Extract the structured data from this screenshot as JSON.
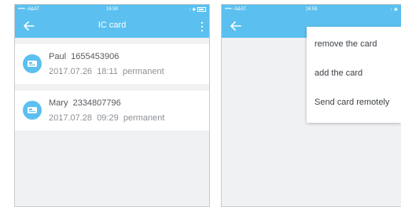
{
  "status_bar": {
    "carrier": "••••◦ A&AT",
    "time": "16:59",
    "right": "↑ ✱"
  },
  "left": {
    "title": "IC card",
    "cards": [
      {
        "name": "Paul",
        "number": "1655453906",
        "date": "2017.07.26",
        "time": "18:11",
        "validity": "permanent"
      },
      {
        "name": "Mary",
        "number": "2334807796",
        "date": "2017.07.28",
        "time": "09:29",
        "validity": "permanent"
      }
    ]
  },
  "right": {
    "menu": [
      {
        "label": "remove the card"
      },
      {
        "label": "add the card"
      },
      {
        "label": "Send card remotely"
      }
    ]
  },
  "colors": {
    "accent": "#5bc0ef",
    "background": "#f0f1f3"
  }
}
